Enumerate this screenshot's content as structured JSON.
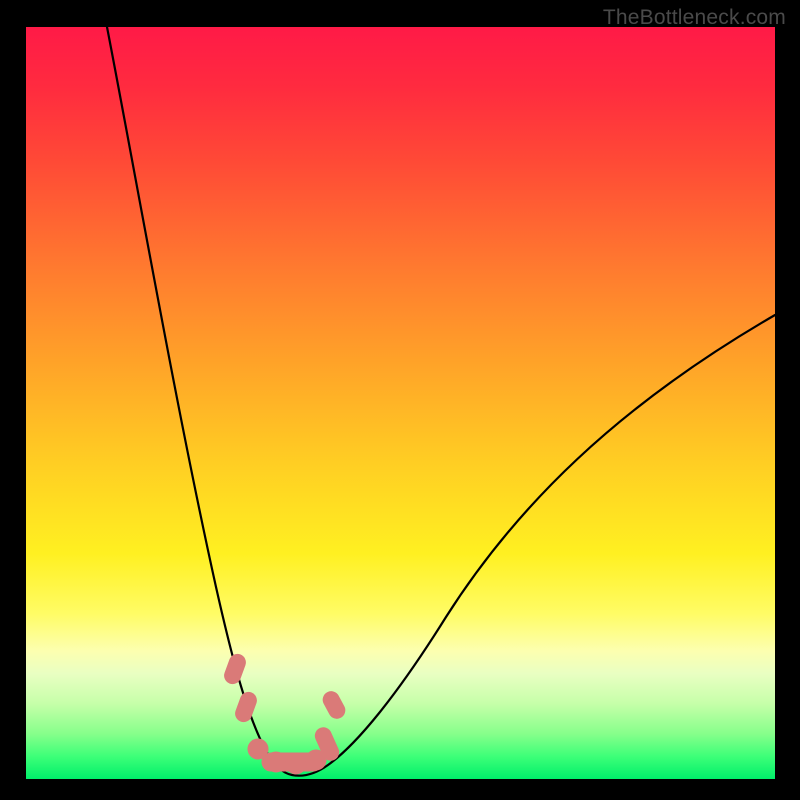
{
  "watermark": "TheBottleneck.com",
  "colors": {
    "frame": "#000000",
    "curve": "#000000",
    "marker": "#da7a78",
    "gradient_top": "#ff1a47",
    "gradient_bottom": "#00ef6a"
  },
  "chart_data": {
    "type": "line",
    "title": "",
    "xlabel": "",
    "ylabel": "",
    "xlim": [
      0,
      100
    ],
    "ylim": [
      0,
      100
    ],
    "notes": "Axes are unlabeled; values are estimated from pixel positions on a 0–100 normalized scale. Curve descends steeply from top-left to a minimum near x≈33 (y≈0) then rises toward the right edge reaching y≈62 at x=100.",
    "series": [
      {
        "name": "curve",
        "x": [
          10.8,
          14,
          18,
          22,
          25,
          27,
          29,
          30.5,
          32,
          33,
          34.5,
          37,
          40,
          45,
          52,
          60,
          70,
          80,
          90,
          100
        ],
        "y": [
          100,
          86,
          68,
          50,
          36,
          26,
          17,
          10,
          4,
          1,
          0.5,
          0.7,
          2,
          6,
          14,
          24,
          36,
          46,
          55,
          62
        ]
      }
    ],
    "markers": [
      {
        "name": "left-upper-dash",
        "x": 28.5,
        "y": 14.5
      },
      {
        "name": "left-lower-dash",
        "x": 29.8,
        "y": 9.5
      },
      {
        "name": "bottom-dot-1",
        "x": 31.5,
        "y": 2.2
      },
      {
        "name": "bottom-dot-2",
        "x": 33.0,
        "y": 1.0
      },
      {
        "name": "bottom-dot-3",
        "x": 35.0,
        "y": 0.8
      },
      {
        "name": "bottom-dot-4",
        "x": 37.0,
        "y": 1.2
      },
      {
        "name": "right-hook",
        "x": 39.5,
        "y": 3.5
      },
      {
        "name": "right-upper-dash",
        "x": 41.0,
        "y": 9.0
      }
    ]
  }
}
